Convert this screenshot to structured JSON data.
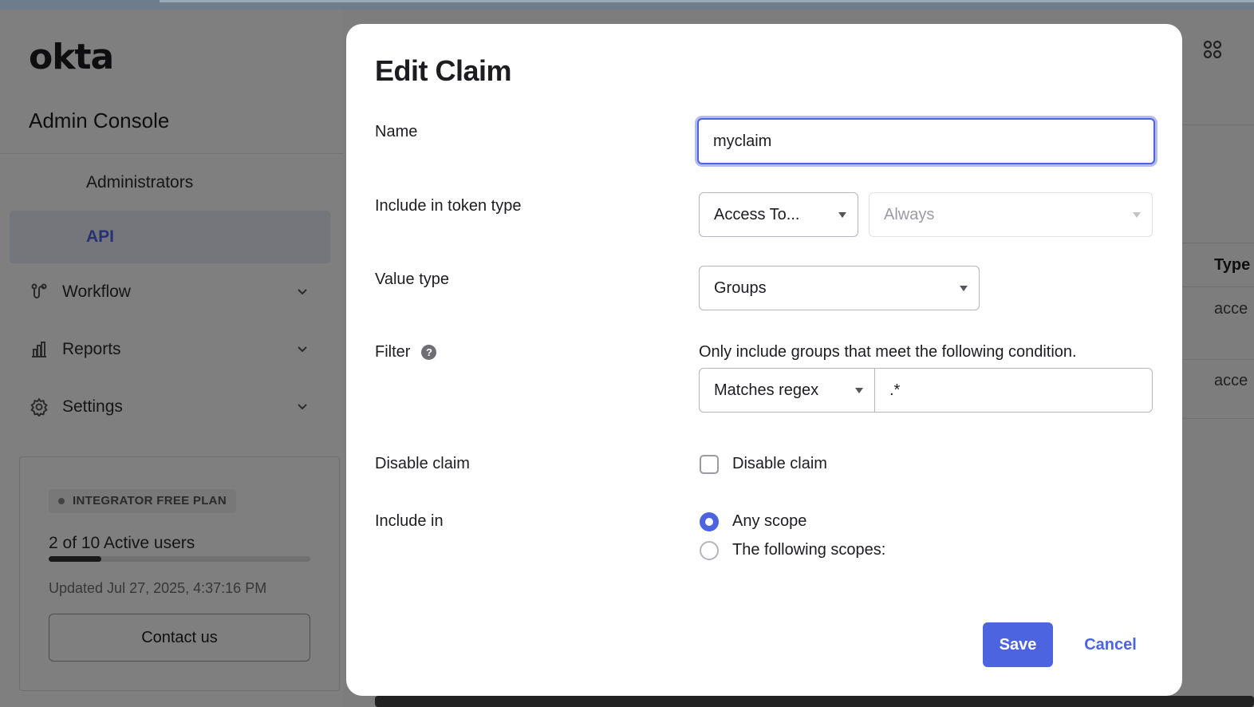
{
  "app": {
    "logo": "okta",
    "console_title": "Admin Console"
  },
  "sidebar": {
    "sub_items": [
      {
        "label": "Administrators"
      },
      {
        "label": "API",
        "active": true
      }
    ],
    "items": [
      {
        "label": "Workflow",
        "icon": "workflow-icon"
      },
      {
        "label": "Reports",
        "icon": "reports-icon"
      },
      {
        "label": "Settings",
        "icon": "settings-icon"
      }
    ]
  },
  "plan": {
    "badge": "INTEGRATOR FREE PLAN",
    "users": "2 of 10 Active users",
    "users_fraction": 0.2,
    "updated": "Updated Jul 27, 2025, 4:37:16 PM",
    "contact_label": "Contact us"
  },
  "background_table": {
    "header": "Type",
    "rows": [
      "acce",
      "acce"
    ]
  },
  "modal": {
    "title": "Edit Claim",
    "labels": {
      "name": "Name",
      "token_type": "Include in token type",
      "value_type": "Value type",
      "filter": "Filter",
      "disable_claim": "Disable claim",
      "include_in": "Include in"
    },
    "fields": {
      "name_value": "myclaim",
      "token_type_value": "Access To...",
      "token_when_value": "Always",
      "value_type_value": "Groups",
      "filter_hint": "Only include groups that meet the following condition.",
      "filter_operator": "Matches regex",
      "filter_value": ".*"
    },
    "disable_claim_checkbox": {
      "label": "Disable claim",
      "checked": false
    },
    "include_in_options": [
      {
        "label": "Any scope",
        "selected": true
      },
      {
        "label": "The following scopes:",
        "selected": false
      }
    ],
    "buttons": {
      "save": "Save",
      "cancel": "Cancel"
    }
  },
  "colors": {
    "accent": "#4c64e0",
    "overlay": "rgba(0,0,0,0.5)"
  }
}
